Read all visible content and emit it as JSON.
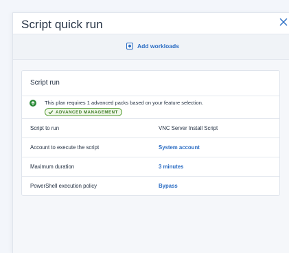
{
  "dialog": {
    "title": "Script quick run"
  },
  "toolbar": {
    "add_workloads_label": "Add workloads"
  },
  "card": {
    "title": "Script run",
    "notice": {
      "text": "This plan requires 1 advanced packs based on your feature selection.",
      "badge": "ADVANCED MANAGEMENT"
    },
    "rows": [
      {
        "label": "Script to run",
        "value": "VNC Server Install Script"
      },
      {
        "label": "Account to execute the script",
        "value": "System account"
      },
      {
        "label": "Maximum duration",
        "value": "3 minutes"
      },
      {
        "label": "PowerShell execution policy",
        "value": "Bypass"
      }
    ]
  },
  "colors": {
    "accent": "#2a6cc3",
    "success": "#2e8b3a",
    "badge_border": "#5aa03a",
    "background": "#f3f6fb"
  },
  "icons": {
    "close": "close-icon",
    "add": "plus-square-icon",
    "notice": "arrow-up-circle-icon",
    "badge": "checkmark-icon"
  }
}
